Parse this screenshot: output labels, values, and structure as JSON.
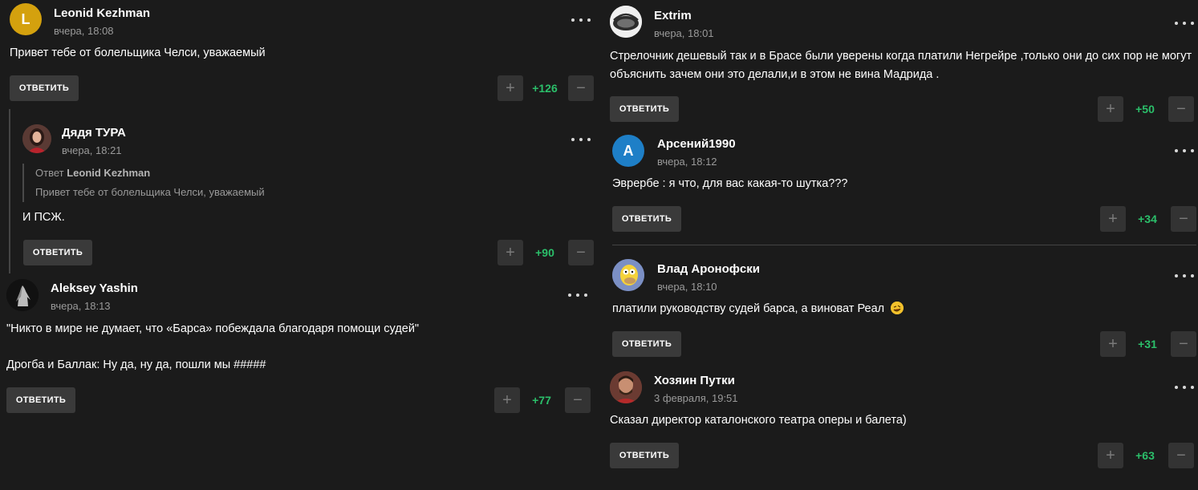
{
  "common": {
    "reply_label": "ОТВЕТИТЬ",
    "plus_symbol": "+",
    "minus_symbol": "−"
  },
  "comments": [
    {
      "author": "Leonid Kezhman",
      "time": "вчера, 18:08",
      "avatar_letter": "L",
      "avatar_color": "#d4a10e",
      "text": "Привет тебе от болельщика Челси, уважаемый",
      "score": "+126"
    },
    {
      "author": "Дядя ТУРА",
      "time": "вчера, 18:21",
      "avatar_icon": "woman-portrait-avatar",
      "quote_prefix": "Ответ",
      "quote_author": "Leonid Kezhman",
      "quote_text": "Привет тебе от болельщика Челси, уважаемый",
      "text": "И ПСЖ.",
      "score": "+90"
    },
    {
      "author": "Aleksey Yashin",
      "time": "вчера, 18:13",
      "avatar_icon": "dark-figure-avatar",
      "text_line1": "\"Никто в мире не думает, что «Барса» побеждала благодаря помощи судей\"",
      "text_line2": "Дрогба и Баллак: Ну да, ну да, пошли мы #####",
      "score": "+77"
    },
    {
      "author": "Extrim",
      "time": "вчера, 18:01",
      "avatar_icon": "stadium-avatar",
      "text_line1": "Стрелочник дешевый так и в Брасе были уверены когда платили Негрейре ,только они до сих пор не могут",
      "text_line2": "объяснить зачем они это делали,и в этом не вина Мадрида .",
      "score": "+50"
    },
    {
      "author": "Арсений1990",
      "time": "вчера, 18:12",
      "avatar_letter": "A",
      "avatar_color": "#1e7fc7",
      "text": "Эврербе : я что, для вас какая-то шутка???",
      "score": "+34"
    },
    {
      "author": "Влад Аронофски",
      "time": "вчера, 18:10",
      "avatar_icon": "cartoon-character-avatar",
      "text": "платили руководству судей барса, а виноват Реал",
      "emoji": "rofl-emoji",
      "score": "+31"
    },
    {
      "author": "Хозяин Путки",
      "time": "3 февраля, 19:51",
      "avatar_icon": "man-portrait-avatar",
      "text": "Сказал директор каталонского театра оперы и балета)",
      "score": "+63"
    }
  ]
}
